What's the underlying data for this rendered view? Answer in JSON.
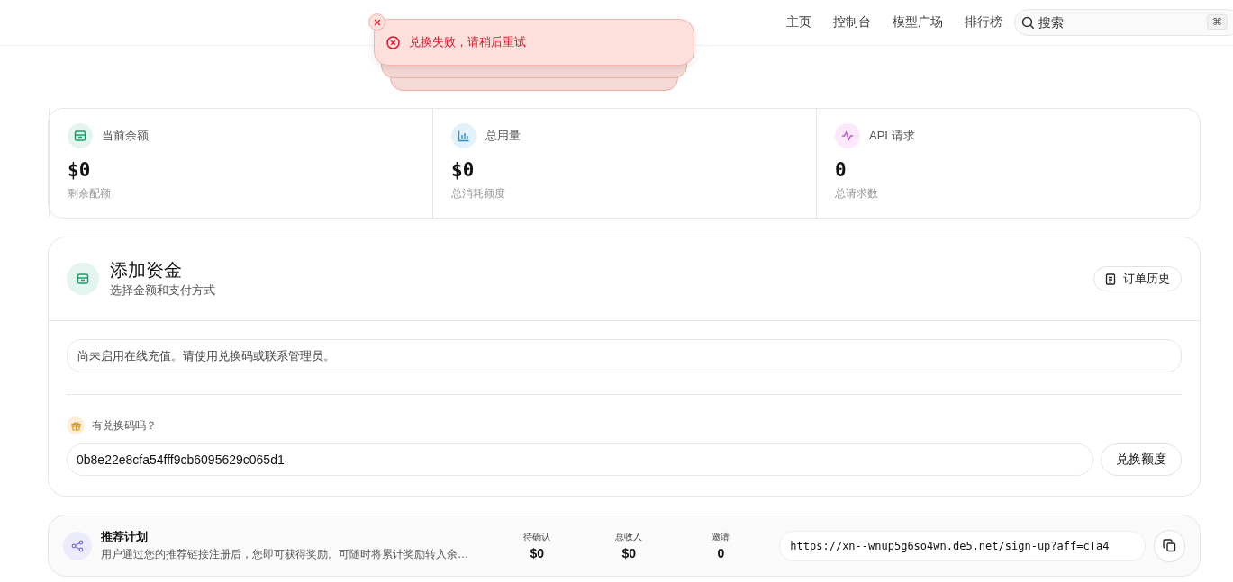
{
  "nav": {
    "links": [
      {
        "label": "主页"
      },
      {
        "label": "控制台"
      },
      {
        "label": "模型广场"
      },
      {
        "label": "排行榜"
      }
    ],
    "search": {
      "placeholder": "搜索",
      "shortcut": "⌘"
    }
  },
  "toast": {
    "kind": "error",
    "message": "兑换失败，请稍后重试"
  },
  "stats": [
    {
      "kind": "wallet",
      "label": "当前余额",
      "value": "$0",
      "caption": "剩余配额"
    },
    {
      "kind": "chart",
      "label": "总用量",
      "value": "$0",
      "caption": "总消耗额度"
    },
    {
      "kind": "pulse",
      "label": "API 请求",
      "value": "0",
      "caption": "总请求数"
    }
  ],
  "add_funds": {
    "title": "添加资金",
    "subtitle": "选择金额和支付方式",
    "history_button": "订单历史",
    "notice": "尚未启用在线充值。请使用兑换码或联系管理员。",
    "redeem_label": "有兑换码吗？",
    "redeem_code": "0b8e22e8cfa54fff9cb6095629c065d1",
    "redeem_button": "兑换额度"
  },
  "referral": {
    "title": "推荐计划",
    "description": "用户通过您的推荐链接注册后，您即可获得奖励。可随时将累计奖励转入余…",
    "stats": [
      {
        "label": "待确认",
        "value": "$0"
      },
      {
        "label": "总收入",
        "value": "$0"
      },
      {
        "label": "邀请",
        "value": "0"
      }
    ],
    "link": "https://xn--wnup5g6so4wn.de5.net/sign-up?aff=cTa4"
  }
}
